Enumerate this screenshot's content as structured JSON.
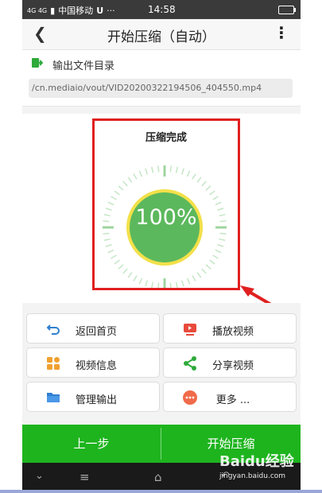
{
  "status_bar": {
    "carrier": "中国移动",
    "network": "4G 4G",
    "time": "14:58"
  },
  "app_bar": {
    "title": "开始压缩（自动）"
  },
  "output": {
    "label": "输出文件目录",
    "path": "/cn.mediaio/vout/VID20200322194506_404550.mp4"
  },
  "progress": {
    "title": "压缩完成",
    "percent_text": "100%",
    "percent": 100
  },
  "actions": [
    {
      "label": "返回首页",
      "icon": "return-icon"
    },
    {
      "label": "播放视频",
      "icon": "play-video-icon"
    },
    {
      "label": "视频信息",
      "icon": "grid-info-icon"
    },
    {
      "label": "分享视频",
      "icon": "share-icon"
    },
    {
      "label": "管理输出",
      "icon": "folder-icon"
    },
    {
      "label": "更多 ...",
      "icon": "more-icon"
    }
  ],
  "bottom": {
    "prev_label": "上一步",
    "start_label": "开始压缩"
  },
  "watermark": {
    "text": "Baidu经验",
    "url": "jingyan.baidu.com"
  },
  "colors": {
    "accent_green": "#1eb41e",
    "dial_green": "#5cb85c",
    "highlight_red": "#e02020"
  }
}
